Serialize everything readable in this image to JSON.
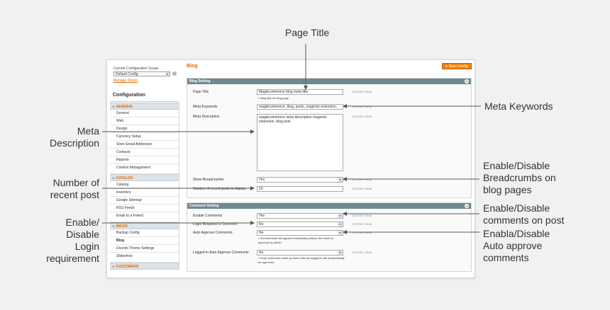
{
  "callouts": {
    "page_title": "Page Title",
    "meta_keywords": "Meta Keywords",
    "meta_description": [
      "Meta",
      "Description"
    ],
    "breadcrumbs": [
      "Enable/Disable",
      "Breadcrumbs on",
      "blog pages"
    ],
    "recent_post": [
      "Number of",
      "recent post"
    ],
    "comments_on_post": [
      "Enable/Disable",
      "comments on post"
    ],
    "login_requirement": [
      "Enable/",
      "Disable",
      "Login",
      "requirement"
    ],
    "auto_approve": [
      "Enabla/Disable",
      "Auto approve",
      "comments"
    ]
  },
  "sidebar": {
    "scope_label": "Current Configuration Scope:",
    "scope_value": "Default Config",
    "manage_stores": "Manage Stores",
    "title": "Configuration",
    "groups": [
      {
        "label": "GENERAL",
        "items": [
          "General",
          "Web",
          "Design",
          "Currency Setup",
          "Store Email Addresses",
          "Contacts",
          "Reports",
          "Content Management"
        ]
      },
      {
        "label": "CATALOG",
        "items": [
          "Catalog",
          "Inventory",
          "Google Sitemap",
          "RSS Feeds",
          "Email to a Friend"
        ]
      },
      {
        "label": "MAGIK",
        "items": [
          "Backup Config",
          "Blog",
          "Dicento Theme Settings",
          "Slideshow"
        ]
      },
      {
        "label": "CUSTOMERS",
        "items": []
      }
    ],
    "active_item": "Blog"
  },
  "main": {
    "heading": "Blog",
    "save_label": "Save Config",
    "blog_section": {
      "title": "Blog Setting",
      "page_title_label": "Page Title",
      "page_title_value": "Magikcommerce blog meta title",
      "page_title_note": "Blog title on blog page",
      "meta_keywords_label": "Meta Keywords",
      "meta_keywords_value": "magikcommerce, blog, posts, magento extension,",
      "meta_description_label": "Meta Description",
      "meta_description_value": "magikcommerce meta description magento extension, blog post",
      "breadcrumbs_label": "Show Breadcrumbs",
      "breadcrumbs_value": "Yes",
      "recent_label": "Number of recent posts to display",
      "recent_value": "10"
    },
    "comment_section": {
      "title": "Comment Setting",
      "enable_label": "Enable Comments",
      "enable_value": "Yes",
      "login_label": "Login Required to Comment",
      "login_value": "No",
      "auto_label": "Auto Approve Comments",
      "auto_value": "No",
      "auto_note": "All comments will appear immediately without the need for approval by admin.",
      "logged_label": "Logged in Auto Approve Comments",
      "logged_value": "No",
      "logged_note": "Only comments made by users that are logged in will automatically be approved."
    },
    "store_view_tag": "[STORE VIEW]"
  },
  "colors": {
    "accent": "#e26703",
    "section_header": "#6f8992",
    "save_button": "#f18200"
  }
}
